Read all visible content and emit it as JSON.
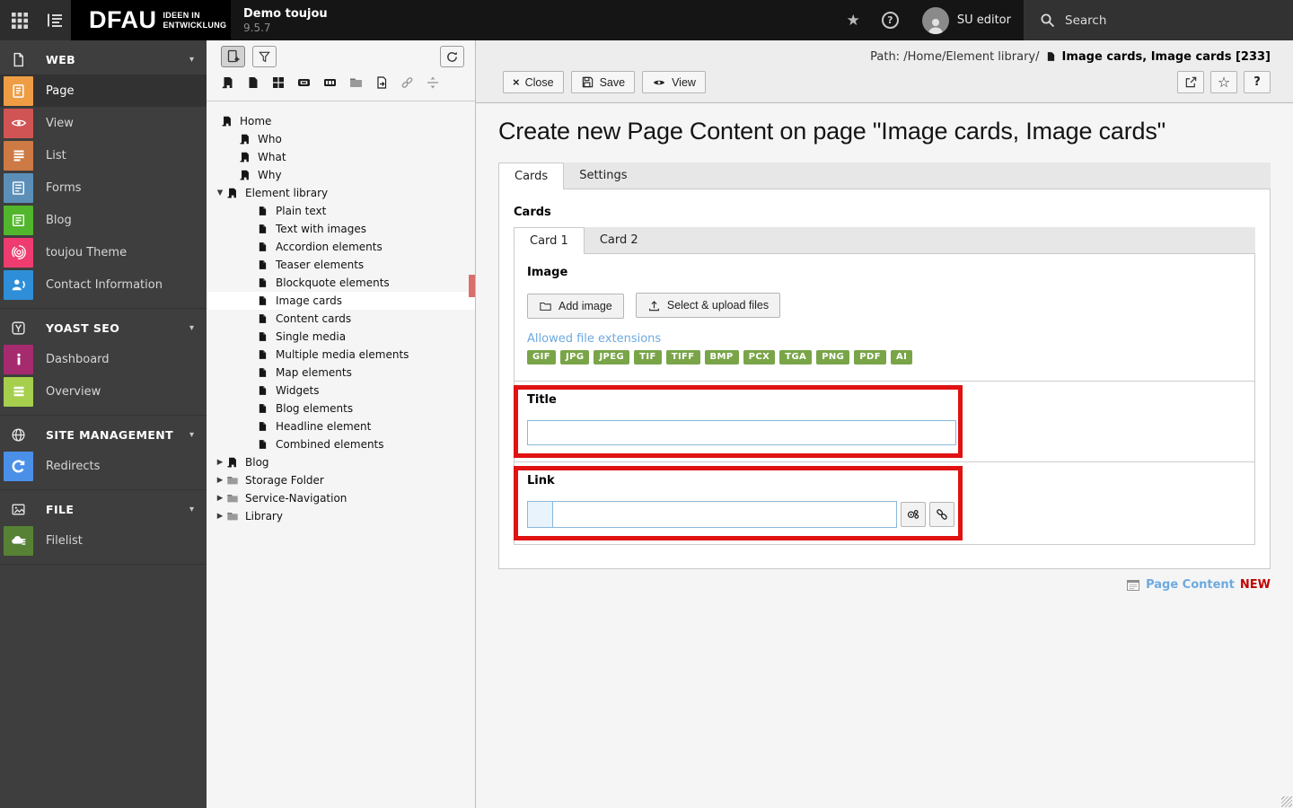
{
  "topbar": {
    "logo": {
      "name": "DFAU",
      "line1": "IDEEN IN",
      "line2": "ENTWICKLUNG"
    },
    "site_name": "Demo toujou",
    "site_version": "9.5.7",
    "user_name": "SU editor",
    "search_label": "Search"
  },
  "icons": {
    "close_glyph": "×",
    "help_glyph": "?",
    "star_filled": "★",
    "star_outline": "☆",
    "caret_open": "▼",
    "caret_closed": "▶",
    "section_caret": "▾"
  },
  "sidebar": {
    "sections": [
      {
        "label": "WEB",
        "items": [
          {
            "label": "Page",
            "color": "#ee9d44"
          },
          {
            "label": "View",
            "color": "#d15454"
          },
          {
            "label": "List",
            "color": "#cd7a45"
          },
          {
            "label": "Forms",
            "color": "#5b8fb8"
          },
          {
            "label": "Blog",
            "color": "#52b62d"
          },
          {
            "label": "toujou Theme",
            "color": "#ee3b70"
          },
          {
            "label": "Contact Information",
            "color": "#2e8fd8"
          }
        ]
      },
      {
        "label": "YOAST SEO",
        "items": [
          {
            "label": "Dashboard",
            "color": "#a62a6e"
          },
          {
            "label": "Overview",
            "color": "#a5cf4c"
          }
        ]
      },
      {
        "label": "SITE MANAGEMENT",
        "items": [
          {
            "label": "Redirects",
            "color": "#4a90e8"
          }
        ]
      },
      {
        "label": "FILE",
        "items": [
          {
            "label": "Filelist",
            "color": "#578235"
          }
        ]
      }
    ]
  },
  "tree": {
    "nodes": [
      {
        "label": "Home"
      },
      {
        "label": "Who"
      },
      {
        "label": "What"
      },
      {
        "label": "Why"
      },
      {
        "label": "Element library"
      },
      {
        "label": "Plain text"
      },
      {
        "label": "Text with images"
      },
      {
        "label": "Accordion elements"
      },
      {
        "label": "Teaser elements"
      },
      {
        "label": "Blockquote elements"
      },
      {
        "label": "Image cards"
      },
      {
        "label": "Content cards"
      },
      {
        "label": "Single media"
      },
      {
        "label": "Multiple media elements"
      },
      {
        "label": "Map elements"
      },
      {
        "label": "Widgets"
      },
      {
        "label": "Blog elements"
      },
      {
        "label": "Headline element"
      },
      {
        "label": "Combined elements"
      },
      {
        "label": "Blog"
      },
      {
        "label": "Storage Folder"
      },
      {
        "label": "Service-Navigation"
      },
      {
        "label": "Library"
      }
    ]
  },
  "docheader": {
    "path_prefix": "Path: /Home/Element library/",
    "record_title": "Image cards, Image cards [233]",
    "close_label": "Close",
    "save_label": "Save",
    "view_label": "View"
  },
  "form": {
    "heading": "Create new Page Content on page \"Image cards, Image cards\"",
    "tabs": [
      "Cards",
      "Settings"
    ],
    "cards_label": "Cards",
    "card_tabs": [
      "Card 1",
      "Card 2"
    ],
    "image_label": "Image",
    "add_image_label": "Add image",
    "upload_label": "Select & upload files",
    "allowed_label": "Allowed file extensions",
    "extensions": [
      "GIF",
      "JPG",
      "JPEG",
      "TIF",
      "TIFF",
      "BMP",
      "PCX",
      "TGA",
      "PNG",
      "PDF",
      "AI"
    ],
    "title_label": "Title",
    "title_value": "",
    "link_label": "Link",
    "link_value": ""
  },
  "footer": {
    "record_type": "Page Content",
    "state": "NEW"
  },
  "colors": {
    "annotation_red": "#e01212",
    "badge_green": "#79a548",
    "link_blue": "#6daae0",
    "new_red": "#c00300"
  }
}
